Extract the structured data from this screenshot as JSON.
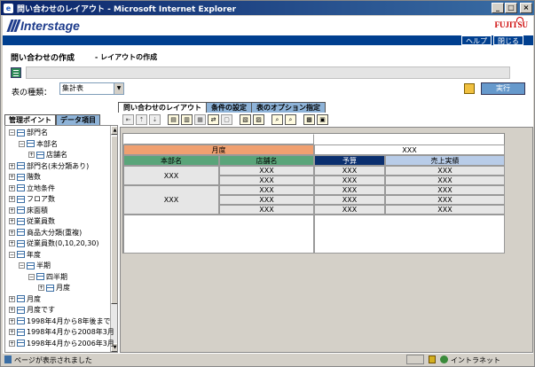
{
  "window": {
    "title": "問い合わせのレイアウト - Microsoft Internet Explorer",
    "min": "_",
    "max": "□",
    "close": "×"
  },
  "header": {
    "logo_text": "Interstage",
    "brand": "FUJITSU",
    "help_link": "ヘルプ",
    "close_link": "閉じる"
  },
  "page": {
    "title": "問い合わせの作成",
    "subtitle": "- レイアウトの作成",
    "kind_label": "表の種類：",
    "kind_value": "集計表",
    "run_label": "実行"
  },
  "left_tabs": [
    "管理ポイント",
    "データ項目"
  ],
  "tree": [
    {
      "label": "部門名",
      "level": 0,
      "pm": "−"
    },
    {
      "label": "本部名",
      "level": 1,
      "pm": "−"
    },
    {
      "label": "店舗名",
      "level": 2,
      "pm": "+"
    },
    {
      "label": "部門名(未分類あり)",
      "level": 0,
      "pm": "+"
    },
    {
      "label": "階数",
      "level": 0,
      "pm": "+"
    },
    {
      "label": "立地条件",
      "level": 0,
      "pm": "+"
    },
    {
      "label": "フロア数",
      "level": 0,
      "pm": "+"
    },
    {
      "label": "床面積",
      "level": 0,
      "pm": "+"
    },
    {
      "label": "従業員数",
      "level": 0,
      "pm": "+"
    },
    {
      "label": "商品大分類(重複)",
      "level": 0,
      "pm": "+"
    },
    {
      "label": "従業員数(0,10,20,30)",
      "level": 0,
      "pm": "+"
    },
    {
      "label": "年度",
      "level": 0,
      "pm": "−"
    },
    {
      "label": "半期",
      "level": 1,
      "pm": "−"
    },
    {
      "label": "四半期",
      "level": 2,
      "pm": "−"
    },
    {
      "label": "月度",
      "level": 3,
      "pm": "+"
    },
    {
      "label": "月度",
      "level": 0,
      "pm": "+"
    },
    {
      "label": "月度です",
      "level": 0,
      "pm": "+"
    },
    {
      "label": "1998年4月から8年後まで",
      "level": 0,
      "pm": "+"
    },
    {
      "label": "1998年4月から2008年3月",
      "level": 0,
      "pm": "+"
    },
    {
      "label": "1998年4月から2006年3月",
      "level": 0,
      "pm": "+"
    }
  ],
  "right_tabs": [
    "問い合わせのレイアウト",
    "条件の設定",
    "表のオプション指定"
  ],
  "grid": {
    "month_header": "月度",
    "xxx_header": "XXX",
    "col_honbu": "本部名",
    "col_tenpo": "店舗名",
    "col_yosan": "予算",
    "col_uriage": "売上実績",
    "xxx": "XXX"
  },
  "status": {
    "text": "ページが表示されました",
    "zone": "イントラネット"
  },
  "colors": {
    "month_bg": "#f0a070",
    "green_bg": "#5aa57a",
    "navy_bg": "#0a2f6f",
    "lightblue_bg": "#b8cce8"
  }
}
